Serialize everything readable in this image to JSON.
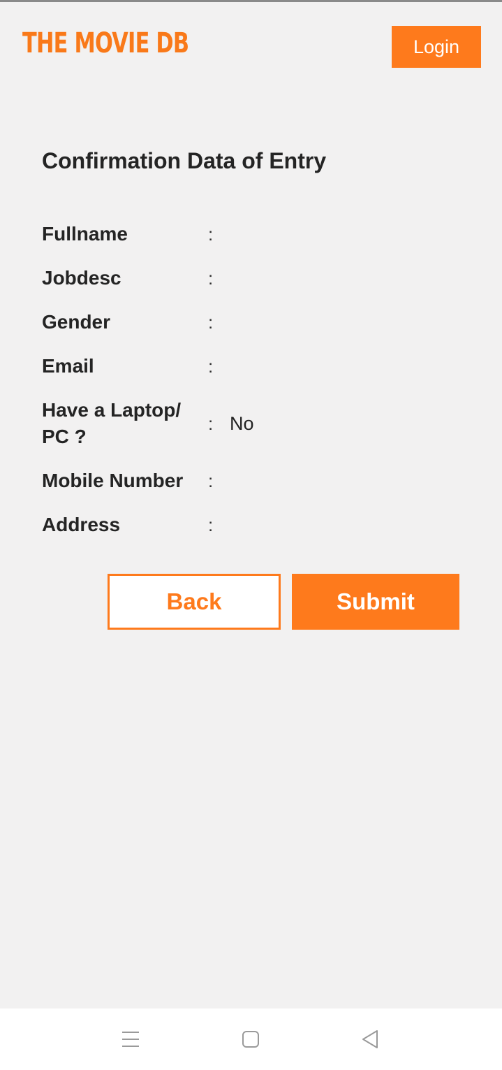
{
  "header": {
    "logo_text": "THE MOVIE DB",
    "login_label": "Login",
    "brand_color": "#fe7a1c"
  },
  "page": {
    "title": "Confirmation Data of Entry"
  },
  "details": {
    "separator": ":",
    "rows": [
      {
        "label": "Fullname",
        "value": ""
      },
      {
        "label": "Jobdesc",
        "value": ""
      },
      {
        "label": "Gender",
        "value": ""
      },
      {
        "label": "Email",
        "value": ""
      },
      {
        "label": "Have a Laptop/ PC ?",
        "value": "No"
      },
      {
        "label": "Mobile Number",
        "value": ""
      },
      {
        "label": "Address",
        "value": ""
      }
    ]
  },
  "actions": {
    "back_label": "Back",
    "submit_label": "Submit"
  },
  "system_nav": {
    "icons": [
      "menu-icon",
      "home-square-icon",
      "back-triangle-icon"
    ]
  }
}
